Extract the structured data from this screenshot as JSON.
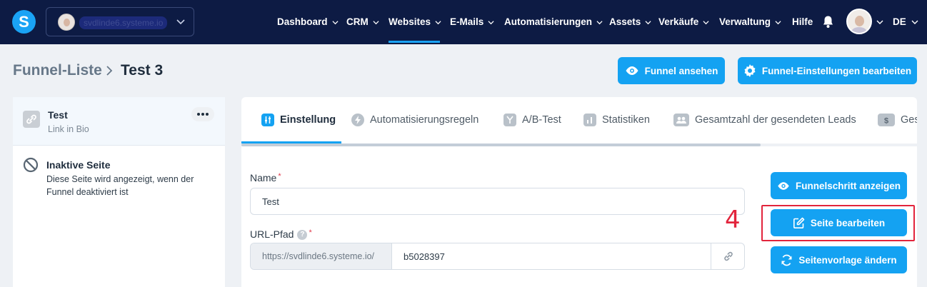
{
  "topbar": {
    "logo_letter": "S",
    "workspace_name": "svdlinde6.systeme.io",
    "nav": [
      {
        "label": "Dashboard"
      },
      {
        "label": "CRM"
      },
      {
        "label": "Websites"
      },
      {
        "label": "E-Mails"
      },
      {
        "label": "Automatisierungen"
      },
      {
        "label": "Assets"
      },
      {
        "label": "Verkäufe"
      },
      {
        "label": "Verwaltung"
      },
      {
        "label": "Hilfe"
      }
    ],
    "active_nav": "Websites",
    "language": "DE"
  },
  "breadcrumb": {
    "root": "Funnel-Liste",
    "current": "Test 3"
  },
  "header_actions": {
    "view_funnel": "Funnel ansehen",
    "edit_funnel_settings": "Funnel-Einstellungen bearbeiten"
  },
  "sidebar": {
    "step": {
      "title": "Test",
      "subtitle": "Link in Bio"
    },
    "inactive": {
      "title": "Inaktive Seite",
      "description": "Diese Seite wird angezeigt, wenn der Funnel deaktiviert ist"
    }
  },
  "tabs": [
    {
      "label": "Einstellung",
      "icon": "sliders-icon"
    },
    {
      "label": "Automatisierungsregeln",
      "icon": "bolt-icon"
    },
    {
      "label": "A/B-Test",
      "icon": "split-icon"
    },
    {
      "label": "Statistiken",
      "icon": "bar-chart-icon"
    },
    {
      "label": "Gesamtzahl der gesendeten Leads",
      "icon": "people-icon"
    },
    {
      "label": "Ges",
      "icon": "dollar-icon"
    }
  ],
  "form": {
    "name_label": "Name",
    "name_value": "Test",
    "url_label": "URL-Pfad",
    "url_prefix": "https://svdlinde6.systeme.io/",
    "url_value": "b5028397",
    "required_mark": "*",
    "help_mark": "?"
  },
  "step_actions": {
    "show_step": "Funnelschritt anzeigen",
    "edit_page": "Seite bearbeiten",
    "change_template": "Seitenvorlage ändern"
  },
  "annotation": {
    "number": "4"
  },
  "colors": {
    "navbar": "#0d1b44",
    "accent": "#14a2f2",
    "annotation": "#e2243c"
  }
}
